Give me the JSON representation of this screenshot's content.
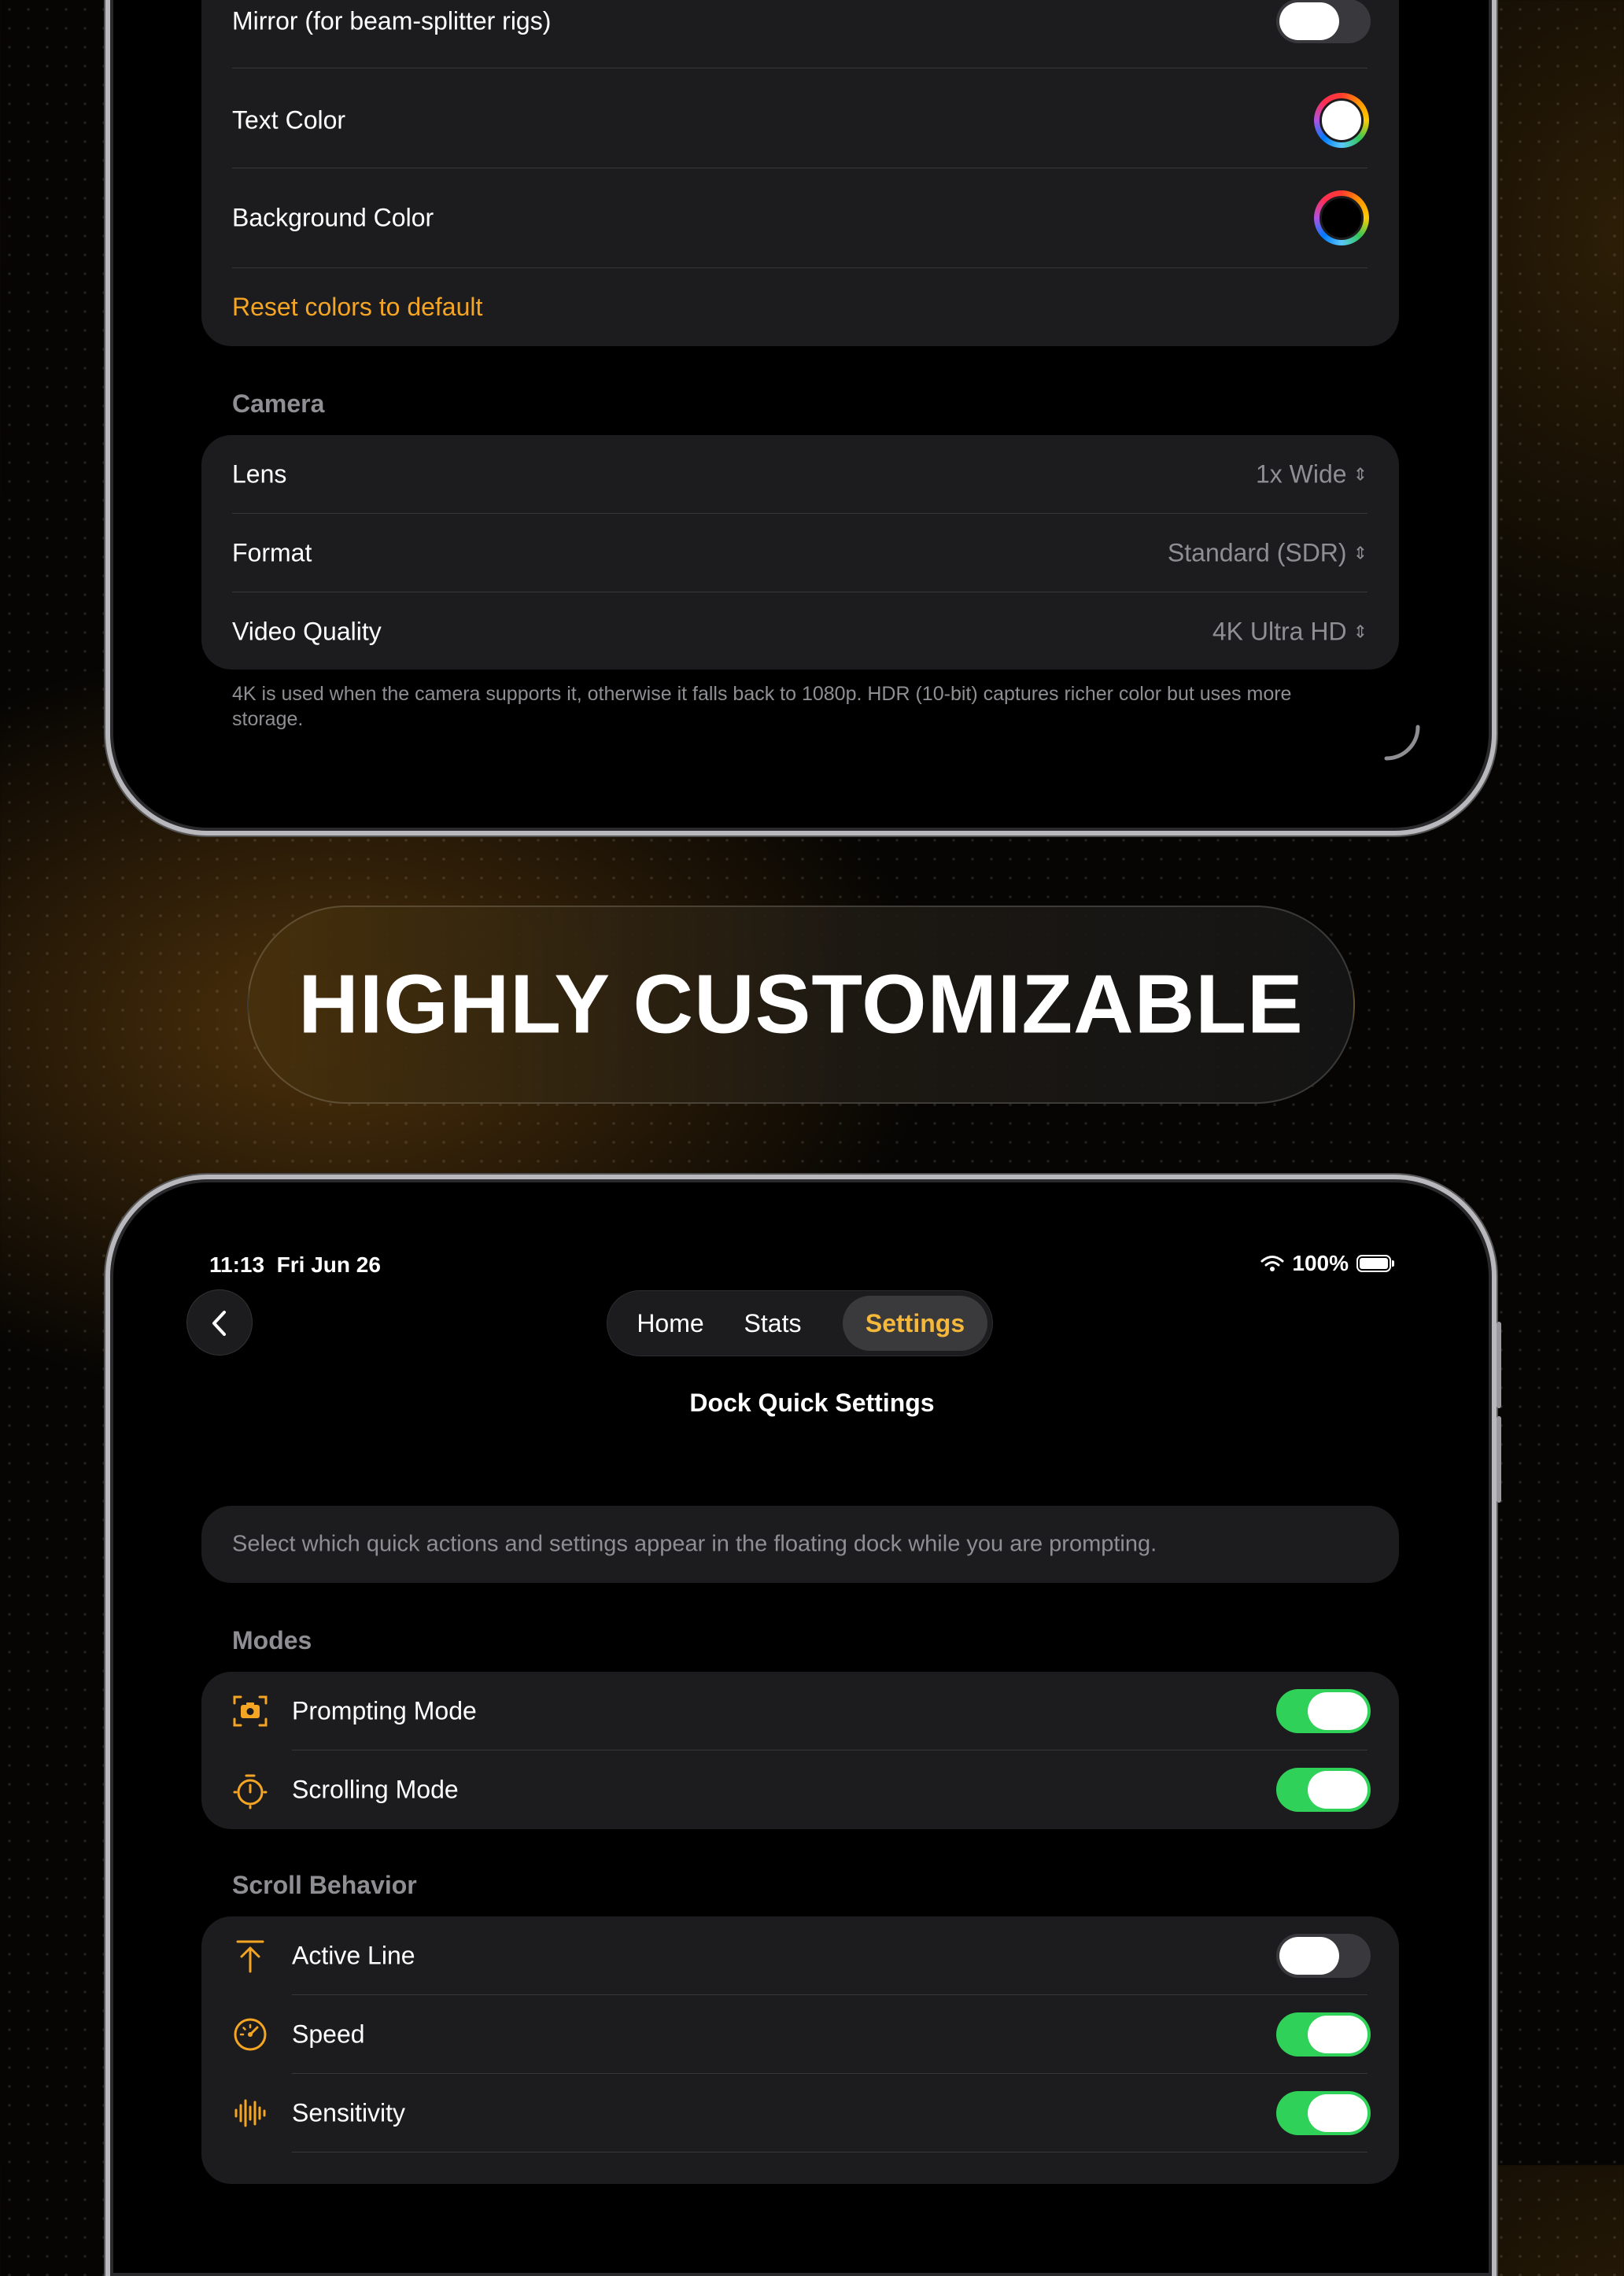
{
  "top_screen": {
    "display_rows": [
      {
        "label": "Mirror (for beam-splitter rigs)",
        "toggle": "off"
      },
      {
        "label": "Text Color",
        "swatch": "#ffffff"
      },
      {
        "label": "Background Color",
        "swatch": "#000000"
      }
    ],
    "reset_label": "Reset colors to default",
    "camera": {
      "header": "Camera",
      "rows": [
        {
          "label": "Lens",
          "value": "1x Wide",
          "chevron": "⌃⌄"
        },
        {
          "label": "Format",
          "value": "Standard (SDR)",
          "chevron": "⌃⌄"
        },
        {
          "label": "Video Quality",
          "value": "4K Ultra HD",
          "chevron": "⌃⌄"
        }
      ],
      "footnote": "4K is used when the camera supports it, otherwise it falls back to 1080p. HDR (10-bit) captures richer color but uses more storage."
    }
  },
  "banner": {
    "text": "HIGHLY CUSTOMIZABLE"
  },
  "bottom_screen": {
    "status_bar": {
      "time": "11:13",
      "date": "Fri Jun 26",
      "battery": "100%"
    },
    "nav": {
      "tabs": [
        {
          "label": "Home"
        },
        {
          "label": "Stats"
        },
        {
          "label": "Settings",
          "active": true
        }
      ]
    },
    "page_title": "Dock Quick Settings",
    "intro": "Select which quick actions and settings appear in the floating dock while you are prompting.",
    "modes": {
      "header": "Modes",
      "rows": [
        {
          "label": "Prompting Mode",
          "icon": "camera-viewfinder-icon",
          "toggle": "on"
        },
        {
          "label": "Scrolling Mode",
          "icon": "timer-icon",
          "toggle": "on"
        }
      ]
    },
    "scroll_behavior": {
      "header": "Scroll Behavior",
      "rows": [
        {
          "label": "Active Line",
          "icon": "arrow-up-to-line-icon",
          "toggle": "off"
        },
        {
          "label": "Speed",
          "icon": "gauge-icon",
          "toggle": "on"
        },
        {
          "label": "Sensitivity",
          "icon": "waveform-icon",
          "toggle": "on"
        }
      ]
    }
  },
  "colors": {
    "accent": "#f5a524",
    "toggle_on": "#30d158",
    "card_bg": "#1c1c1e",
    "secondary_text": "#8e8e93"
  }
}
